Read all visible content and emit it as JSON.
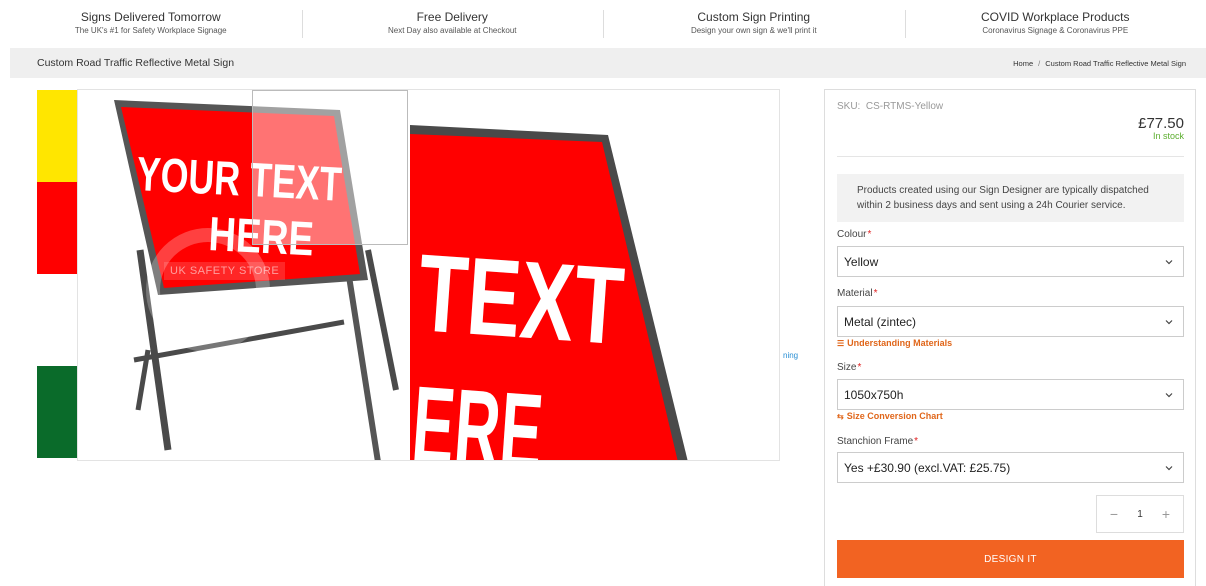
{
  "usp": [
    {
      "title": "Signs Delivered Tomorrow",
      "subtitle": "The UK's #1 for Safety Workplace Signage"
    },
    {
      "title": "Free Delivery",
      "subtitle": "Next Day also available at Checkout"
    },
    {
      "title": "Custom Sign Printing",
      "subtitle": "Design your own sign & we'll print it"
    },
    {
      "title": "COVID Workplace Products",
      "subtitle": "Coronavirus Signage & Coronavirus PPE"
    }
  ],
  "page": {
    "title": "Custom Road Traffic Reflective Metal Sign",
    "breadcrumb": [
      "Home",
      "Custom Road Traffic Reflective Metal Sign"
    ],
    "breadcrumb_sep": "/"
  },
  "thumbs": {
    "colors": [
      "#ffe600",
      "#ff0000",
      "#ffffff",
      "#0a6b2a"
    ]
  },
  "gallery": {
    "sign_text_line1": "YOUR TEXT",
    "sign_text_line2": "HERE",
    "zoom_text_line1": "TEXT",
    "zoom_text_line2": "ERE",
    "watermark": "UK SAFETY STORE",
    "zoom_link_fragment": "ning"
  },
  "product": {
    "sku_label": "SKU:",
    "sku_value": "CS-RTMS-Yellow",
    "price": "£77.50",
    "stock": "In stock",
    "notice": "Products created using our Sign Designer are typically dispatched within 2 business days and sent using a 24h Courier service.",
    "colour_label": "Colour",
    "colour_value": "Yellow",
    "material_label": "Material",
    "material_value": "Metal (zintec)",
    "material_help": "Understanding Materials",
    "size_label": "Size",
    "size_value": "1050x750h",
    "size_help": "Size Conversion Chart",
    "frame_label": "Stanchion Frame",
    "frame_value": "Yes +£30.90 (excl.VAT: £25.75)",
    "required_mark": "*",
    "qty_minus": "−",
    "qty_value": "1",
    "qty_plus": "+",
    "design_button": "DESIGN IT"
  },
  "colors": {
    "accent": "#f26322",
    "stock": "#5cae2f",
    "required": "#e02020",
    "sign_red": "#ff0000"
  }
}
